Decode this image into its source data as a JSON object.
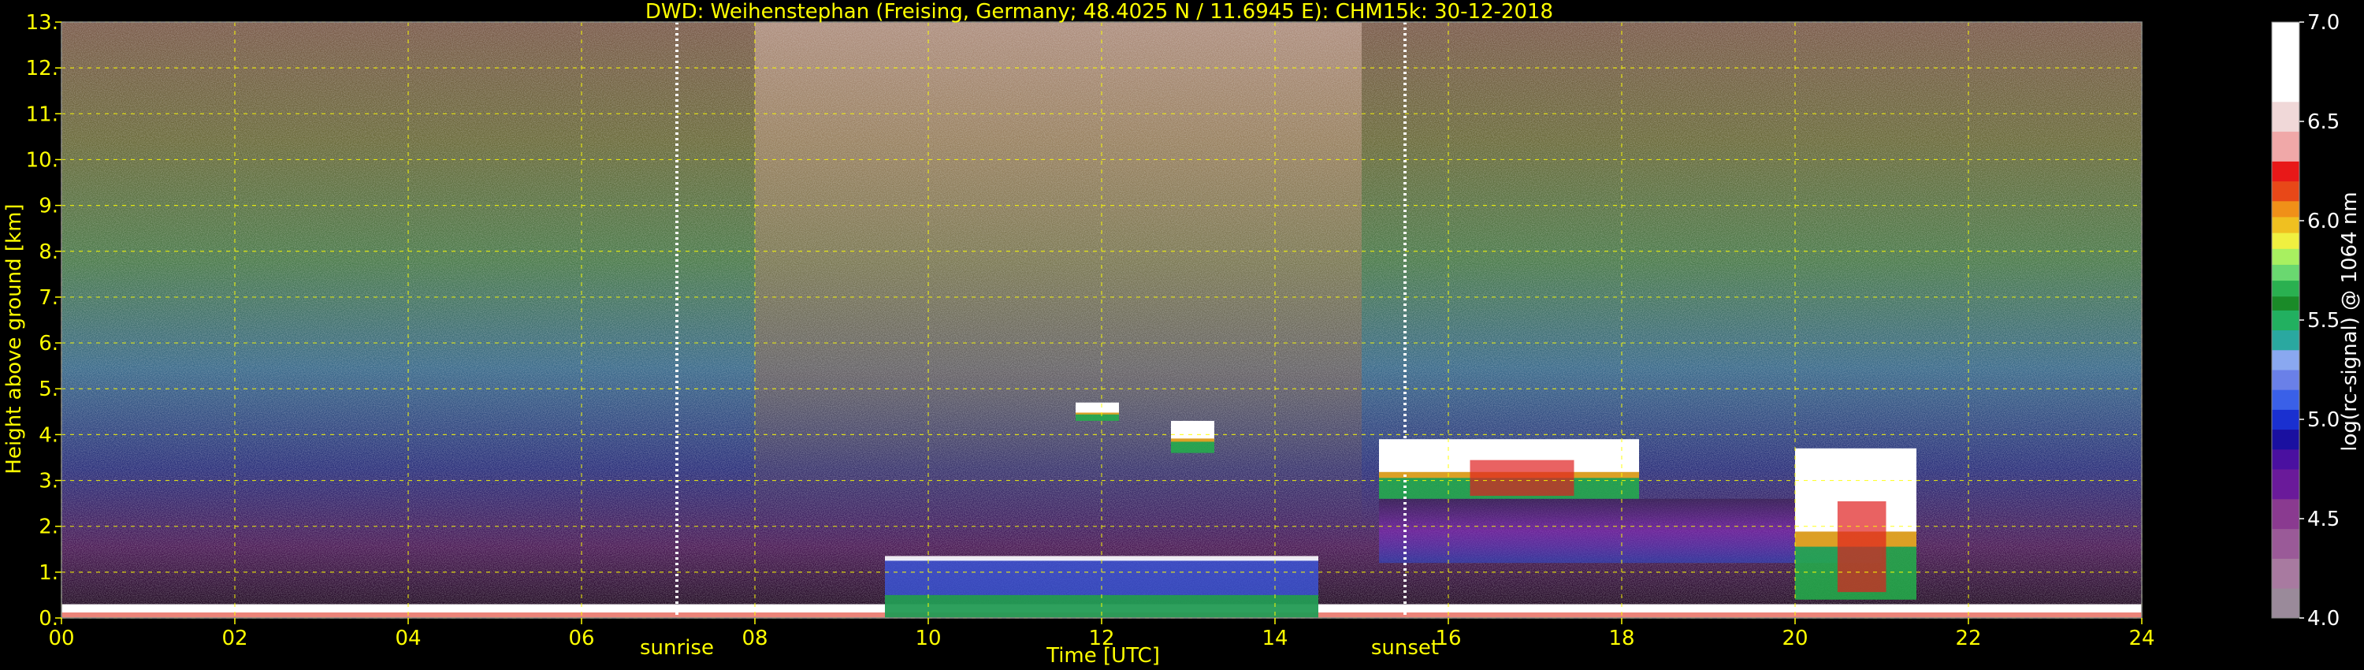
{
  "chart_data": {
    "type": "heatmap",
    "title": "DWD: Weihenstephan (Freising, Germany; 48.4025 N / 11.6945 E):    CHM15k: 30-12-2018",
    "xlabel": "Time [UTC]",
    "ylabel": "Height above ground [km]",
    "xlim": [
      0,
      24
    ],
    "ylim": [
      0,
      13
    ],
    "x_ticks": [
      "00",
      "02",
      "04",
      "06",
      "08",
      "10",
      "12",
      "14",
      "16",
      "18",
      "20",
      "22",
      "24"
    ],
    "y_ticks": [
      "0.",
      "1.",
      "2.",
      "3.",
      "4.",
      "5.",
      "6.",
      "7.",
      "8.",
      "9.",
      "10.",
      "11.",
      "12.",
      "13."
    ],
    "grid": true,
    "markers": [
      {
        "label": "sunrise",
        "x": 7.1
      },
      {
        "label": "sunset",
        "x": 15.5
      }
    ],
    "colorbar": {
      "label": "log(rc-signal) @ 1064 nm",
      "range": [
        4.0,
        7.0
      ],
      "ticks": [
        "4.0",
        "4.5",
        "5.0",
        "5.5",
        "6.0",
        "6.5",
        "7.0"
      ]
    },
    "features": [
      {
        "name": "surface aerosol layer",
        "x": [
          0,
          24
        ],
        "top_km": 0.3
      },
      {
        "name": "boundary layer",
        "x": [
          9.5,
          14.5
        ],
        "top_km": 1.3
      },
      {
        "name": "cloud",
        "x": [
          11.7,
          12.2
        ],
        "height_km": [
          4.3,
          4.7
        ]
      },
      {
        "name": "cloud",
        "x": [
          12.8,
          13.3
        ],
        "height_km": [
          3.6,
          4.3
        ]
      },
      {
        "name": "cloud deck",
        "x": [
          15.2,
          18.2
        ],
        "height_km": [
          2.6,
          3.9
        ]
      },
      {
        "name": "cloud",
        "x": [
          20.0,
          21.4
        ],
        "height_km": [
          0.4,
          3.7
        ]
      }
    ]
  },
  "colors": {
    "background": "#000000",
    "text": "#ffff00",
    "grid": "#ffff00",
    "colorbar_text": "#ffffff"
  }
}
